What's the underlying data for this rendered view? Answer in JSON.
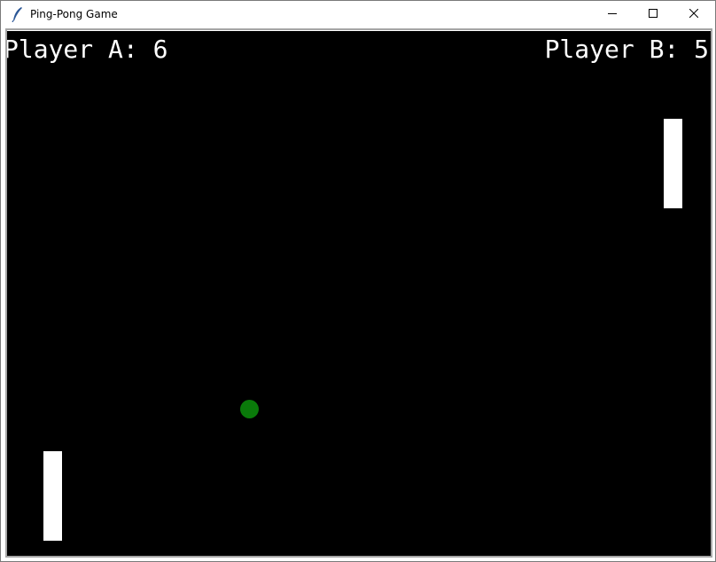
{
  "window": {
    "title": "Ping-Pong Game",
    "icon": "feather-icon",
    "controls": [
      "minimize-icon",
      "maximize-icon",
      "close-icon"
    ]
  },
  "game": {
    "background_color": "#000000",
    "score_a_text": "Player A: 6",
    "score_b_text": "Player B: 5",
    "player_a_score": 6,
    "player_b_score": 5,
    "paddle_color": "#ffffff",
    "ball_color": "#0a7a0a"
  }
}
